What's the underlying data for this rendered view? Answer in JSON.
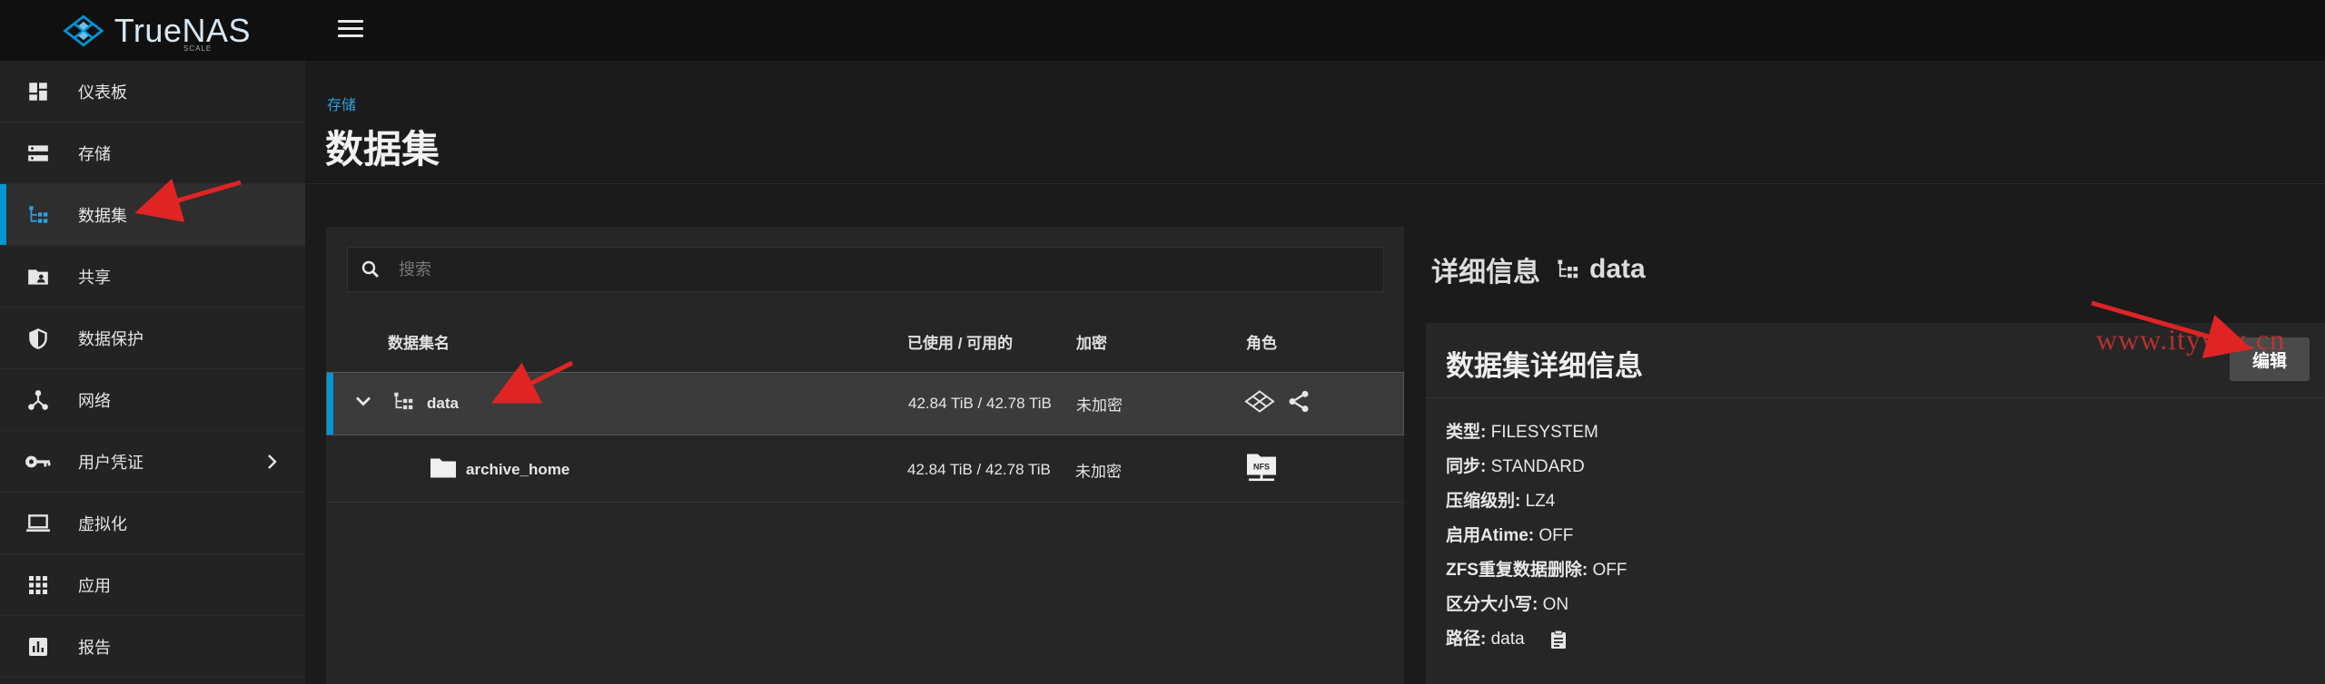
{
  "app": {
    "brand": "TrueNAS",
    "brand_sub": "SCALE"
  },
  "sidebar": {
    "items": [
      {
        "label": "仪表板",
        "icon": "dashboard-icon"
      },
      {
        "label": "存储",
        "icon": "storage-icon"
      },
      {
        "label": "数据集",
        "icon": "dataset-icon",
        "active": true
      },
      {
        "label": "共享",
        "icon": "shares-icon"
      },
      {
        "label": "数据保护",
        "icon": "shield-icon"
      },
      {
        "label": "网络",
        "icon": "network-icon"
      },
      {
        "label": "用户凭证",
        "icon": "key-icon",
        "has_submenu": true
      },
      {
        "label": "虚拟化",
        "icon": "laptop-icon"
      },
      {
        "label": "应用",
        "icon": "apps-grid-icon"
      },
      {
        "label": "报告",
        "icon": "reports-icon"
      }
    ]
  },
  "header": {
    "breadcrumb": "存储",
    "title": "数据集"
  },
  "search": {
    "placeholder": "搜索"
  },
  "table": {
    "columns": [
      "数据集名",
      "已使用 / 可用的",
      "加密",
      "角色"
    ],
    "rows": [
      {
        "name": "data",
        "usage": "42.84 TiB / 42.78 TiB",
        "encryption": "未加密",
        "roles": [
          "pool-icon",
          "share-icon"
        ]
      },
      {
        "name": "archive_home",
        "usage": "42.84 TiB / 42.78 TiB",
        "encryption": "未加密",
        "roles": [
          "nfs-share-icon"
        ]
      }
    ]
  },
  "details": {
    "title": "详细信息",
    "dataset": "data",
    "card_title": "数据集详细信息",
    "edit_label": "编辑",
    "watermark": "www.itywlx.cn",
    "fields": [
      {
        "key": "类型:",
        "value": "FILESYSTEM"
      },
      {
        "key": "同步:",
        "value": "STANDARD"
      },
      {
        "key": "压缩级别:",
        "value": "LZ4"
      },
      {
        "key": "启用Atime:",
        "value": "OFF"
      },
      {
        "key": "ZFS重复数据删除:",
        "value": "OFF"
      },
      {
        "key": "区分大小写:",
        "value": "ON"
      },
      {
        "key": "路径:",
        "value": "data"
      }
    ]
  },
  "colors": {
    "accent": "#0095d5",
    "annotation": "#e02424"
  }
}
